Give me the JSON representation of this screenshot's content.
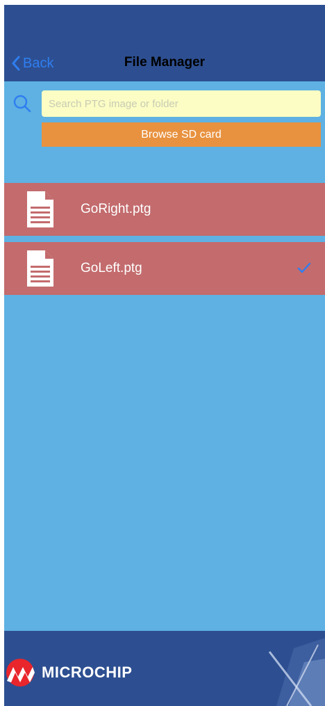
{
  "navbar": {
    "back_label": "Back",
    "title": "File Manager"
  },
  "search": {
    "placeholder": "Search PTG image or folder",
    "value": ""
  },
  "browse": {
    "label": "Browse SD card"
  },
  "files": [
    {
      "name": "GoRight.ptg",
      "icon": "document-icon",
      "selected": false
    },
    {
      "name": "GoLeft.ptg",
      "icon": "document-icon",
      "selected": true
    }
  ],
  "footer": {
    "brand": "MICROCHIP"
  },
  "colors": {
    "navbar": "#2d4f91",
    "background": "#5eb1e2",
    "search_field": "#fbfdc4",
    "browse_button": "#e8923f",
    "file_row": "#c36b6d",
    "accent": "#2f7ef0",
    "logo_red": "#e8262c"
  }
}
